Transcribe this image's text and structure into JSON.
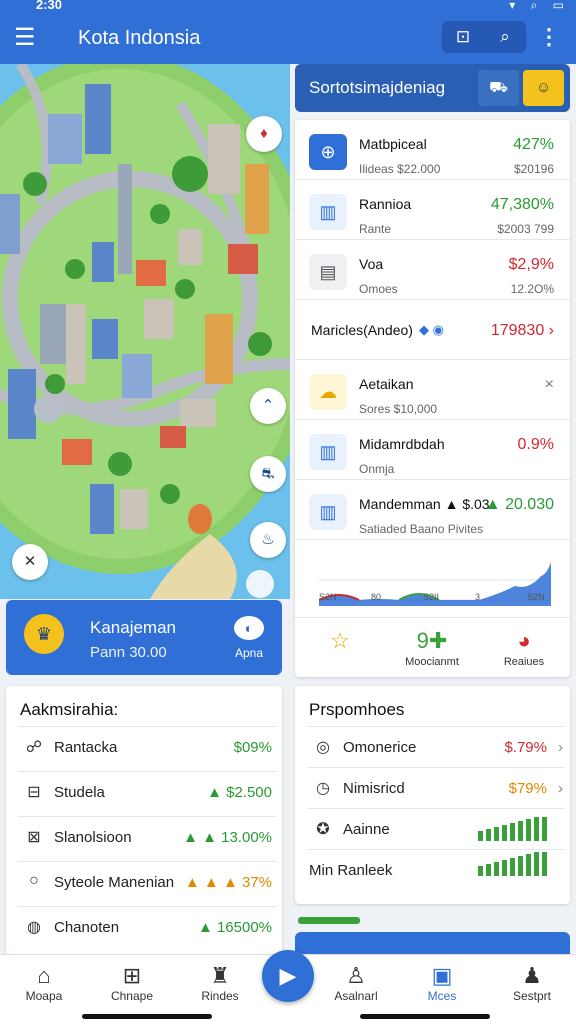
{
  "status": {
    "time": "2:30",
    "icons": "▾ ⌕ ▭"
  },
  "appbar": {
    "menu_icon": "☰",
    "title": "Kota Indonsia",
    "action1": "⊡",
    "action2": "⌕",
    "more": "⋮"
  },
  "map": {
    "controls": [
      "⌃",
      "⛐",
      "♨",
      "⌂"
    ],
    "pin": "♦",
    "close": "✕"
  },
  "kcard": {
    "icon": "♛",
    "title": "Kanajeman",
    "subtitle": "Pann 30.00",
    "right_label": "Apna"
  },
  "rhead": {
    "title": "Sortotsimajdeniag",
    "b1": "⛟",
    "b2": "☺"
  },
  "market": [
    {
      "name": "Matbpiceal",
      "sub": "Ilideas $22.000",
      "value": "427%",
      "svalue": "$20196",
      "dir": "up",
      "icon": "⊕",
      "icon_bg": "#2f6fd6",
      "icon_fg": "#fff"
    },
    {
      "name": "Rannioa",
      "sub": "Rante",
      "value": "47,380%",
      "svalue": "$2003 799",
      "dir": "up",
      "icon": "▥",
      "icon_bg": "#e8f1fd",
      "icon_fg": "#2f6fd6"
    },
    {
      "name": "Voa",
      "sub": "Omoes",
      "value": "$2,9%",
      "svalue": "12.2O%",
      "dir": "dn",
      "icon": "▤",
      "icon_bg": "#eef0f3",
      "icon_fg": "#555"
    },
    {
      "name": "Maricles(Andeo)",
      "sub": "",
      "value": "179830 ›",
      "svalue": "",
      "dir": "dn",
      "icon": "",
      "icon_bg": "transparent",
      "icon_fg": "#2f6fd6",
      "tag": "◆ ◉"
    },
    {
      "name": "Aetaikan",
      "sub": "Sores $10,000",
      "value": "×",
      "svalue": "",
      "dir": "mute",
      "icon": "☁",
      "icon_bg": "#fff6d6",
      "icon_fg": "#e6a800"
    },
    {
      "name": "Midamrdbdah",
      "sub": "Onmja",
      "value": "0.9%",
      "svalue": "",
      "dir": "dn",
      "icon": "▥",
      "icon_bg": "#e8f1fd",
      "icon_fg": "#2f6fd6"
    },
    {
      "name": "Mandemman ▲ $.03.",
      "sub": "Satiaded Baano Pivites",
      "value": "▲ 20.030",
      "svalue": "",
      "dir": "up",
      "icon": "▥",
      "icon_bg": "#e8f1fd",
      "icon_fg": "#2f6fd6"
    }
  ],
  "mini_chart": {
    "ticks": [
      "S2N",
      "80",
      "S2II",
      "3",
      "S2N"
    ],
    "series_color": "#2f6fd6"
  },
  "mfoot": [
    {
      "g": "☆",
      "label": ""
    },
    {
      "g": "9✚",
      "label": "Moocianmt"
    },
    {
      "g": "◕",
      "label": "Reaiues"
    }
  ],
  "admin": {
    "title": "Aakmsirahia:",
    "rows": [
      {
        "i": "☍",
        "name": "Rantacka",
        "value": "$09%",
        "dir": "up"
      },
      {
        "i": "⊟",
        "name": "Studela",
        "value": "▲ $2.500",
        "dir": "up"
      },
      {
        "i": "⊠",
        "name": "Slanolsioon",
        "value": "▲ ▲ 13.00%",
        "dir": "up"
      },
      {
        "i": "○",
        "name": "Syteole Manenian",
        "value": "▲ ▲ ▲ 37%",
        "dir": "dn"
      },
      {
        "i": "◍",
        "name": "Chanoten",
        "value": "▲ 16500%",
        "dir": "up"
      }
    ]
  },
  "promo": {
    "title": "Prspomhoes",
    "rows": [
      {
        "i": "◎",
        "name": "Omonerice",
        "value": "$.79%",
        "dir": "dn",
        "chev": "›"
      },
      {
        "i": "◷",
        "name": "Nimisricd",
        "value": "$79%",
        "dir": "warn",
        "chev": "›"
      },
      {
        "i": "✪",
        "name": "Aainne",
        "value": "",
        "dir": "bars"
      },
      {
        "i": "",
        "name": "Min Ranleek",
        "value": "",
        "dir": "bars"
      }
    ]
  },
  "nav": [
    {
      "g": "⌂",
      "label": "Moapa"
    },
    {
      "g": "⊞",
      "label": "Chnape"
    },
    {
      "g": "♜",
      "label": "Rindes"
    },
    {
      "g": "♙",
      "label": "Asalnarl"
    },
    {
      "g": "▣",
      "label": "Mces"
    },
    {
      "g": "♟",
      "label": "Sestprt"
    }
  ],
  "fab": "▶",
  "colors": {
    "primary": "#2f6fd6",
    "green": "#2a9a35",
    "red": "#d0282e"
  }
}
